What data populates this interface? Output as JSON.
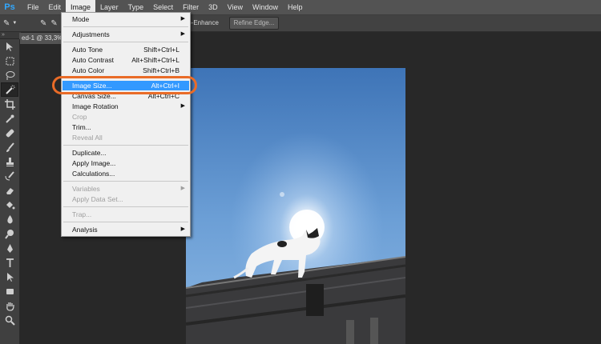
{
  "app": {
    "logo": "Ps"
  },
  "menubar": {
    "items": [
      "File",
      "Edit",
      "Image",
      "Layer",
      "Type",
      "Select",
      "Filter",
      "3D",
      "View",
      "Window",
      "Help"
    ]
  },
  "options_bar": {
    "enhance_label": "to-Enhance",
    "refine_button": "Refine Edge..."
  },
  "document_tab": {
    "title": "ed-1 @ 33,3%"
  },
  "image_menu": {
    "items": [
      {
        "label": "Mode",
        "shortcut": "",
        "submenu": true
      },
      {
        "label": "Adjustments",
        "shortcut": "",
        "submenu": true
      },
      {
        "label": "Auto Tone",
        "shortcut": "Shift+Ctrl+L"
      },
      {
        "label": "Auto Contrast",
        "shortcut": "Alt+Shift+Ctrl+L"
      },
      {
        "label": "Auto Color",
        "shortcut": "Shift+Ctrl+B"
      },
      {
        "label": "Image Size...",
        "shortcut": "Alt+Ctrl+I"
      },
      {
        "label": "Canvas Size...",
        "shortcut": "Alt+Ctrl+C"
      },
      {
        "label": "Image Rotation",
        "shortcut": "",
        "submenu": true
      },
      {
        "label": "Crop",
        "shortcut": ""
      },
      {
        "label": "Trim...",
        "shortcut": ""
      },
      {
        "label": "Reveal All",
        "shortcut": ""
      },
      {
        "label": "Duplicate...",
        "shortcut": ""
      },
      {
        "label": "Apply Image...",
        "shortcut": ""
      },
      {
        "label": "Calculations...",
        "shortcut": ""
      },
      {
        "label": "Variables",
        "shortcut": "",
        "submenu": true
      },
      {
        "label": "Apply Data Set...",
        "shortcut": ""
      },
      {
        "label": "Trap...",
        "shortcut": ""
      },
      {
        "label": "Analysis",
        "shortcut": "",
        "submenu": true
      }
    ],
    "submenu_arrow": "▶"
  },
  "tools": [
    "move-tool-icon",
    "marquee-tool-icon",
    "lasso-tool-icon",
    "quick-selection-tool-icon",
    "crop-tool-icon",
    "eyedropper-tool-icon",
    "healing-brush-tool-icon",
    "brush-tool-icon",
    "clone-stamp-tool-icon",
    "history-brush-tool-icon",
    "eraser-tool-icon",
    "paint-bucket-tool-icon",
    "blur-tool-icon",
    "dodge-tool-icon",
    "pen-tool-icon",
    "type-tool-icon",
    "path-selection-tool-icon",
    "rectangle-tool-icon",
    "hand-tool-icon",
    "zoom-tool-icon"
  ],
  "colors": {
    "highlight_ring": "#e96b27",
    "menu_highlight": "#3399ff",
    "app_background": "#282828"
  }
}
